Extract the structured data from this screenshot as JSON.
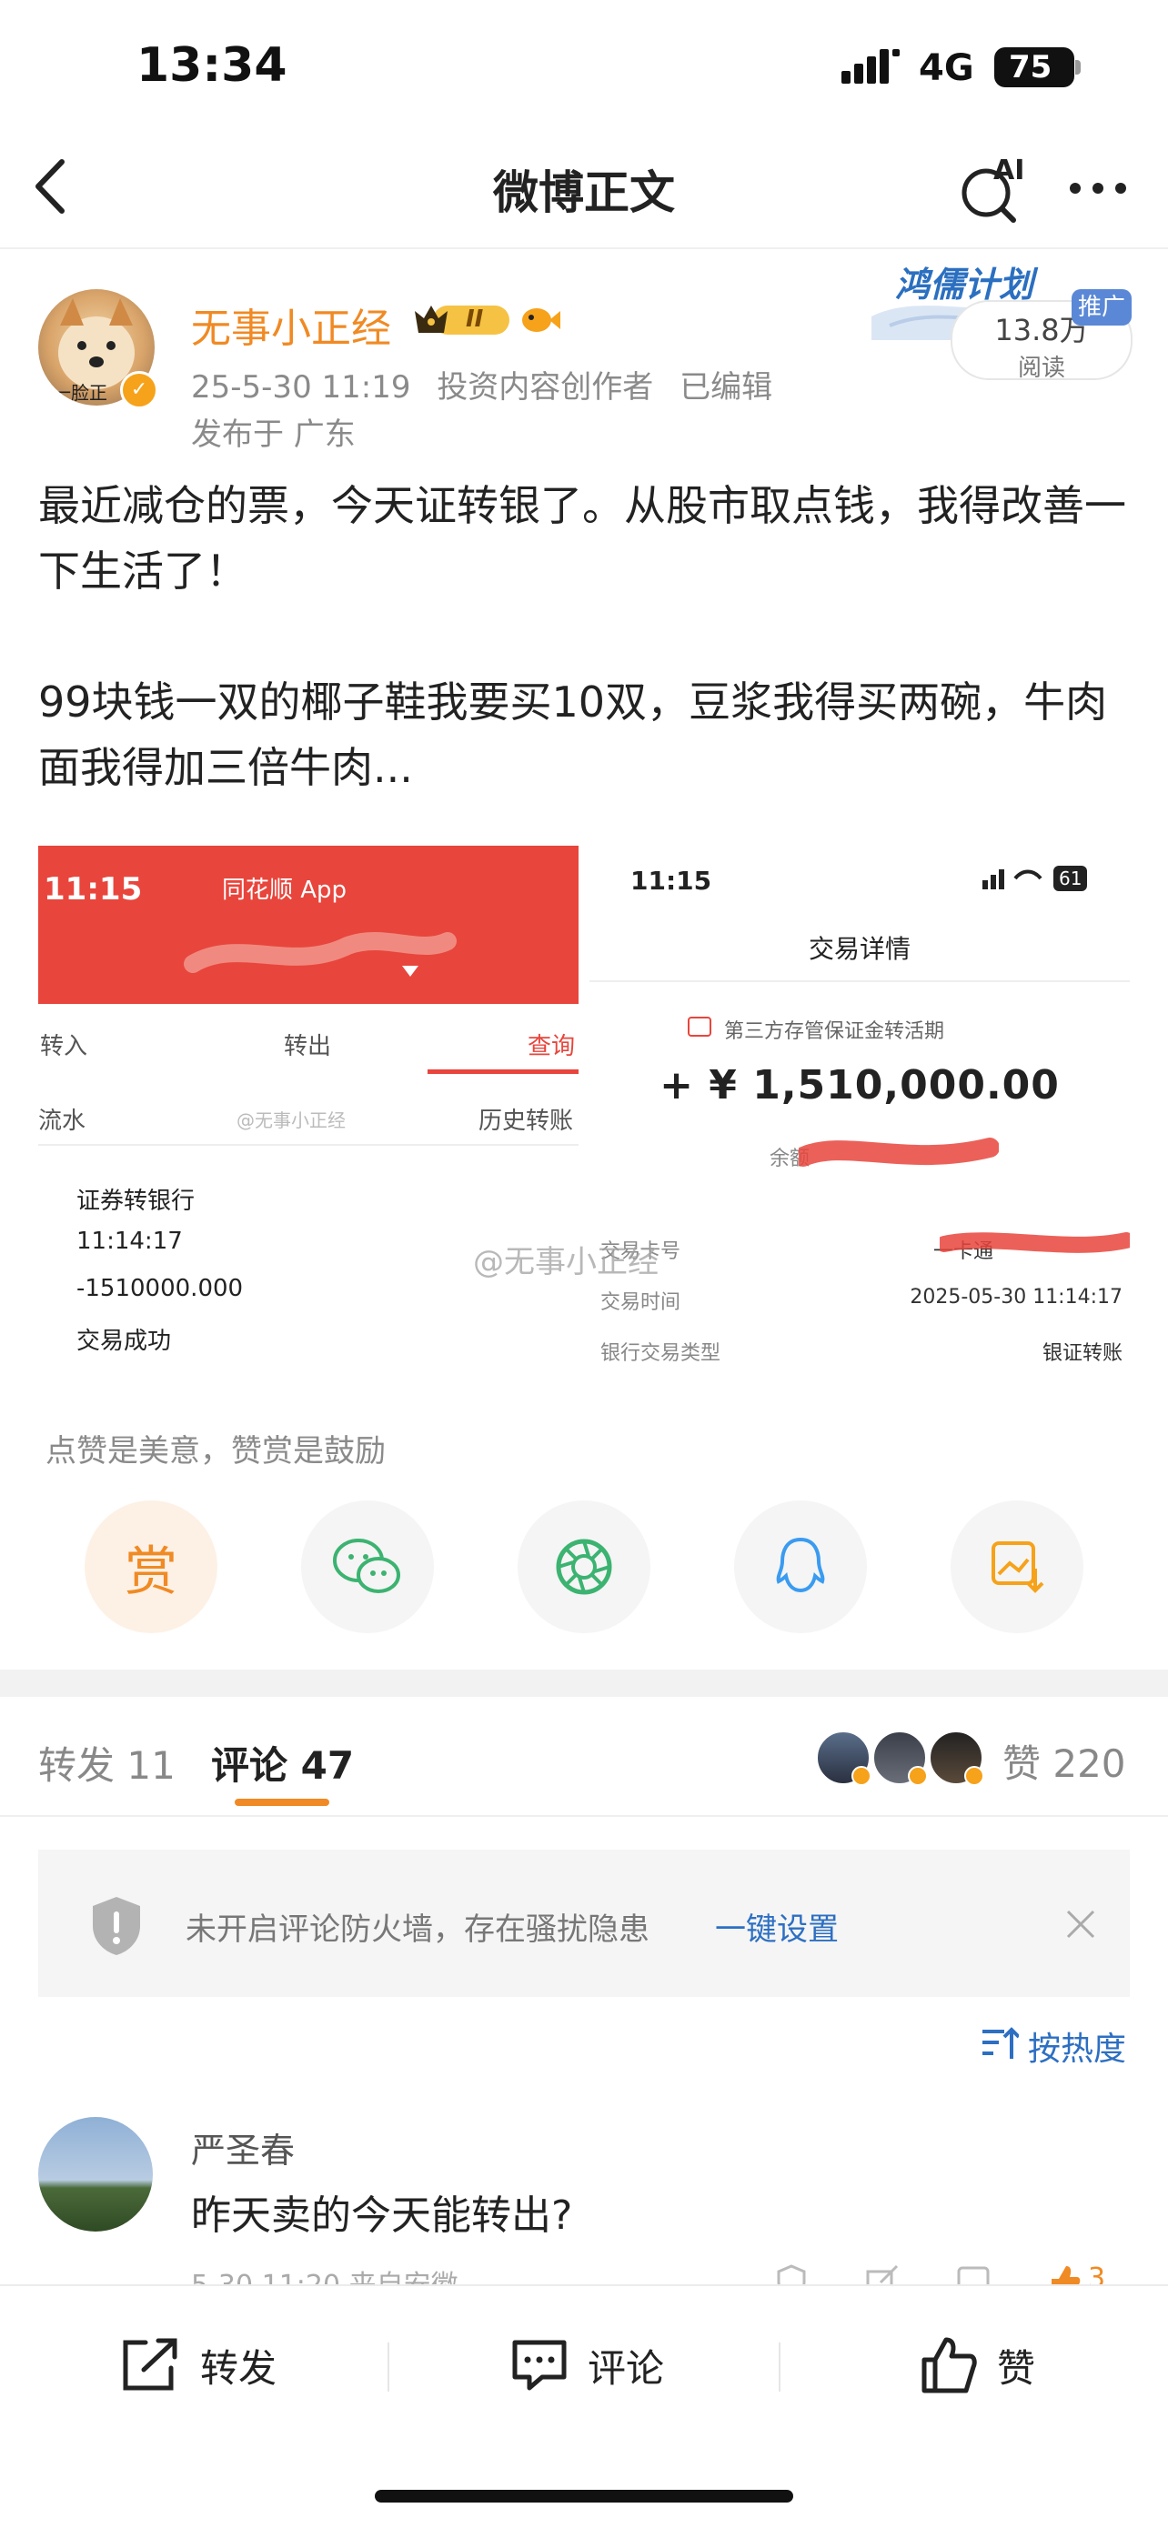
{
  "status_bar": {
    "time": "13:34",
    "network": "4G",
    "battery": "75"
  },
  "nav": {
    "title": "微博正文",
    "ai_label": "AI"
  },
  "author": {
    "name": "无事小正经",
    "avatar_text": "一脸正",
    "level_badge": "II",
    "date": "25-5-30 11:19",
    "role": "投资内容创作者",
    "edited": "已编辑",
    "location": "发布于 广东",
    "plan_label": "鸿儒计划",
    "promo_tag": "推广",
    "read_count": "13.8万",
    "read_label": "阅读"
  },
  "post": {
    "line1": "最近减仓的票，今天证转银了。从股市取点钱，我得改善一下生活了！",
    "line2": "99块钱一双的椰子鞋我要买10双，豆浆我得买两碗，牛肉面我得加三倍牛肉..."
  },
  "image_left": {
    "time": "11:15",
    "app_name": "同花顺 App",
    "tabs": [
      "转入",
      "转出",
      "查询"
    ],
    "sub_left": "流水",
    "sub_watermark": "@无事小正经",
    "sub_right": "历史转账",
    "records": [
      "证券转银行",
      "11:14:17",
      "-1510000.000",
      "交易成功"
    ]
  },
  "image_right": {
    "time": "11:15",
    "battery": "61",
    "title": "交易详情",
    "subtitle": "第三方存管保证金转活期",
    "amount": "+ ¥ 1,510,000.00",
    "balance_label": "余额",
    "rows": [
      {
        "label": "交易卡号",
        "value": "一卡通"
      },
      {
        "label": "交易时间",
        "value": "2025-05-30 11:14:17"
      },
      {
        "label": "银行交易类型",
        "value": "银证转账"
      }
    ]
  },
  "watermark": "@无事小正经",
  "reward_tip": "点赞是美意，赞赏是鼓励",
  "reward_char": "赏",
  "share_icons": [
    "reward-icon",
    "wechat-icon",
    "moments-icon",
    "qq-icon",
    "save-image-icon"
  ],
  "tabs": {
    "forward": "转发 11",
    "comment": "评论 47",
    "like": "赞 220"
  },
  "firewall": {
    "text": "未开启评论防火墙，存在骚扰隐患",
    "link": "一键设置"
  },
  "sort_label": "按热度",
  "comment": {
    "name": "严圣春",
    "text": "昨天卖的今天能转出?",
    "meta": "5-30 11:20  来自安徽",
    "like_count": "3"
  },
  "bottom_bar": {
    "forward": "转发",
    "comment": "评论",
    "like": "赞"
  },
  "colors": {
    "brand_orange": "#f08a24",
    "link_blue": "#2d6fc2",
    "red": "#e8453c"
  }
}
